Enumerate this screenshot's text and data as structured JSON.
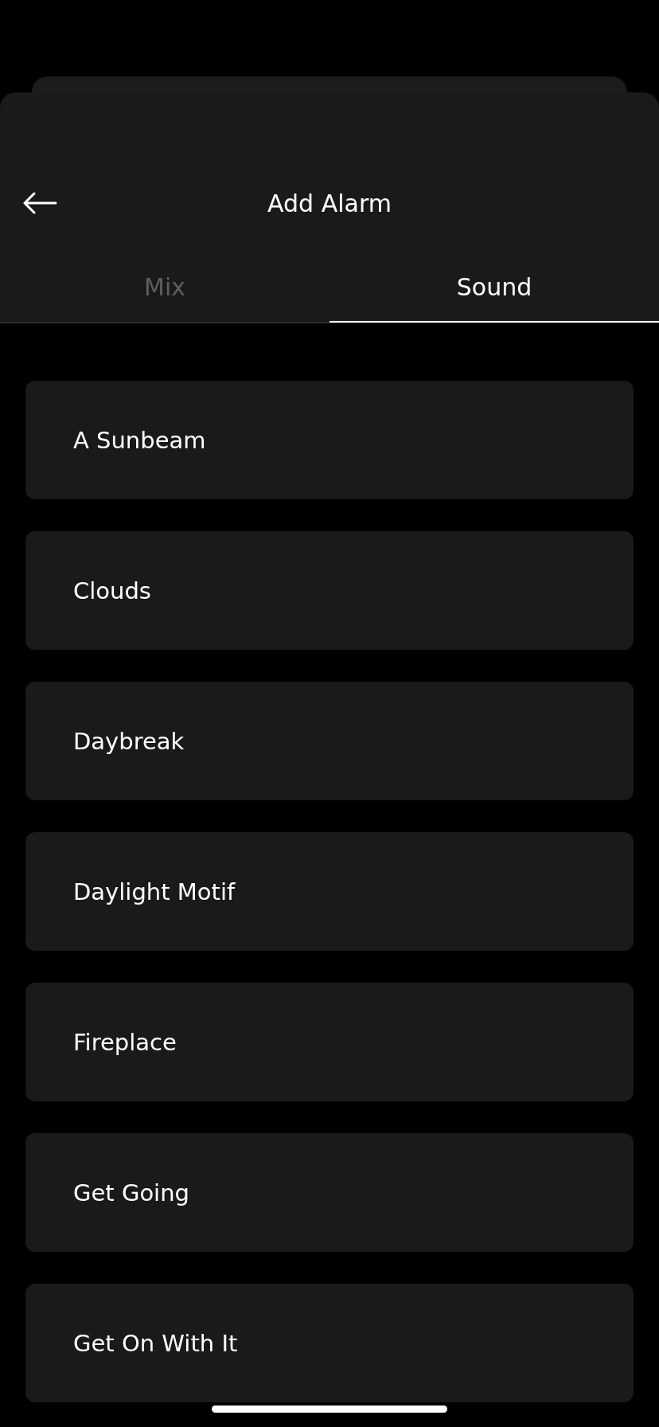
{
  "header": {
    "title": "Add Alarm"
  },
  "tabs": [
    {
      "label": "Mix",
      "selected": false
    },
    {
      "label": "Sound",
      "selected": true
    }
  ],
  "sounds": [
    {
      "name": "A Sunbeam"
    },
    {
      "name": "Clouds"
    },
    {
      "name": "Daybreak"
    },
    {
      "name": "Daylight Motif"
    },
    {
      "name": "Fireplace"
    },
    {
      "name": "Get Going"
    },
    {
      "name": "Get On With It"
    }
  ]
}
